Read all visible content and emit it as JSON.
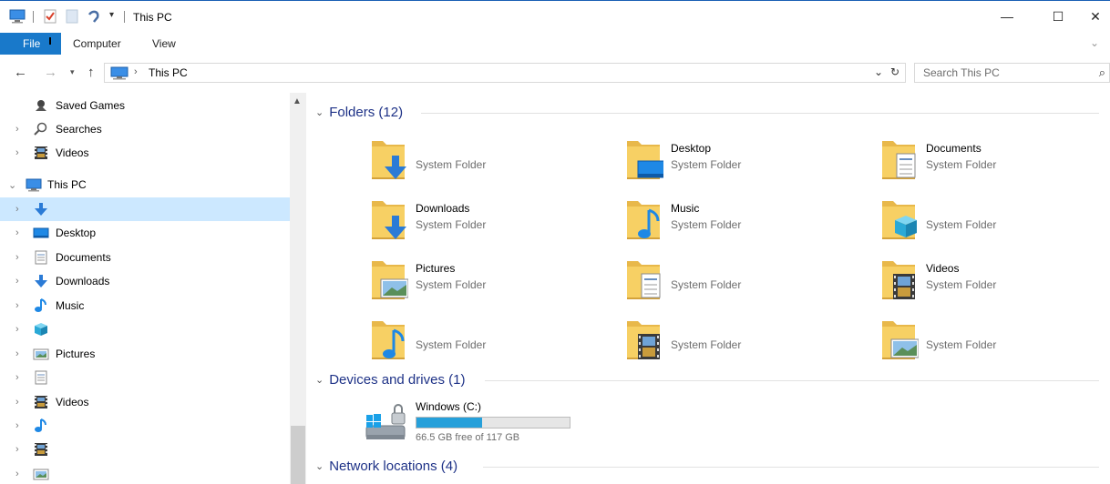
{
  "window": {
    "title": "This PC",
    "minimize": "—",
    "maximize": "☐",
    "close": "✕"
  },
  "ribbon": {
    "file_tab": "File",
    "tabs": [
      "Computer",
      "View"
    ],
    "expand_glyph": "⌄"
  },
  "address": {
    "crumb": "This PC",
    "search_placeholder": "Search This PC"
  },
  "navpane": {
    "items": [
      {
        "label": "Saved Games",
        "icon": "saved-games-icon",
        "expander": ""
      },
      {
        "label": "Searches",
        "icon": "search-folder-icon",
        "expander": "›"
      },
      {
        "label": "Videos",
        "icon": "videos-icon",
        "expander": "›"
      },
      {
        "label": "This PC",
        "icon": "computer-icon",
        "expander": "⌄"
      },
      {
        "label": "",
        "icon": "downloads-icon",
        "expander": "›",
        "selected": true
      },
      {
        "label": "Desktop",
        "icon": "desktop-icon",
        "expander": "›"
      },
      {
        "label": "Documents",
        "icon": "documents-icon",
        "expander": "›"
      },
      {
        "label": "Downloads",
        "icon": "downloads-icon",
        "expander": "›"
      },
      {
        "label": "Music",
        "icon": "music-icon",
        "expander": "›"
      },
      {
        "label": "",
        "icon": "3d-objects-icon",
        "expander": "›"
      },
      {
        "label": "Pictures",
        "icon": "pictures-icon",
        "expander": "›"
      },
      {
        "label": "",
        "icon": "documents-icon",
        "expander": "›"
      },
      {
        "label": "Videos",
        "icon": "videos-icon",
        "expander": "›"
      },
      {
        "label": "",
        "icon": "music-icon",
        "expander": "›"
      },
      {
        "label": "",
        "icon": "videos-icon",
        "expander": "›"
      },
      {
        "label": "",
        "icon": "pictures-icon",
        "expander": "›"
      }
    ]
  },
  "groups": {
    "folders": "Folders (12)",
    "devices": "Devices and drives (1)",
    "network": "Network locations (4)"
  },
  "folders": [
    {
      "name": "",
      "type": "System Folder",
      "overlay": "download"
    },
    {
      "name": "Desktop",
      "type": "System Folder",
      "overlay": "desktop"
    },
    {
      "name": "Documents",
      "type": "System Folder",
      "overlay": "document"
    },
    {
      "name": "Downloads",
      "type": "System Folder",
      "overlay": "download"
    },
    {
      "name": "Music",
      "type": "System Folder",
      "overlay": "music"
    },
    {
      "name": "",
      "type": "System Folder",
      "overlay": "cube"
    },
    {
      "name": "Pictures",
      "type": "System Folder",
      "overlay": "picture"
    },
    {
      "name": "",
      "type": "System Folder",
      "overlay": "document"
    },
    {
      "name": "Videos",
      "type": "System Folder",
      "overlay": "video"
    },
    {
      "name": "",
      "type": "System Folder",
      "overlay": "music"
    },
    {
      "name": "",
      "type": "System Folder",
      "overlay": "video"
    },
    {
      "name": "",
      "type": "System Folder",
      "overlay": "picture"
    }
  ],
  "drive": {
    "name": "Windows (C:)",
    "free_text": "66.5 GB free of 117 GB",
    "used_fraction": 0.43
  },
  "colors": {
    "accent": "#1979ca",
    "selection": "#cce8ff",
    "group_header": "#1e3287",
    "drive_bar": "#26a0da"
  }
}
